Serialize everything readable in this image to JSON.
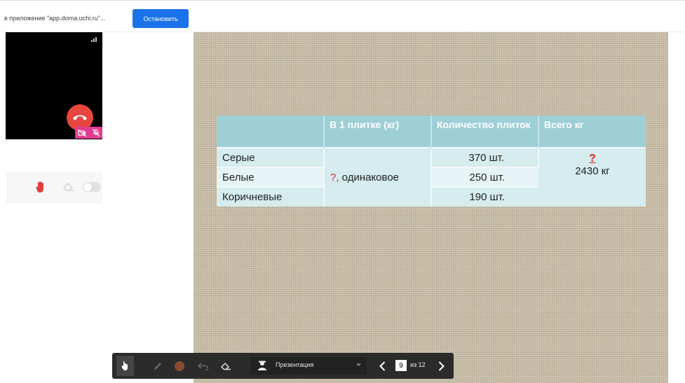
{
  "share_bar": {
    "text": "в приложение \"app.doma.uchi.ru\"...",
    "stop_label": "Остановить"
  },
  "call": {
    "video_icons": [
      "signal-icon",
      "hangup-icon",
      "camera-off-icon",
      "mic-off-icon"
    ]
  },
  "controls": {
    "icons": [
      "raise-hand-icon",
      "eraser-icon",
      "toggle-switch"
    ]
  },
  "slide": {
    "headers": [
      "",
      "В 1 плитке (кг)",
      "Количество плиток",
      "Всего кг"
    ],
    "rows": [
      {
        "name": "Серые",
        "count": "370 шт."
      },
      {
        "name": "Белые",
        "count": "250 шт."
      },
      {
        "name": "Коричневые",
        "count": "190 шт."
      }
    ],
    "per_tile_q": "?,",
    "per_tile_text": " одинаковое",
    "total_q": "?",
    "total_value": "2430 кг"
  },
  "toolbar": {
    "mode_label": "Презентация",
    "current_page": "9",
    "page_of": "из 12"
  },
  "colors": {
    "stop_button": "#1a73e8",
    "hangup": "#e7453f",
    "muted_badge": "#e23b8f",
    "table_header": "#9ecfd7",
    "question_mark": "#d62a2a",
    "pen_color": "#8a4a32"
  }
}
